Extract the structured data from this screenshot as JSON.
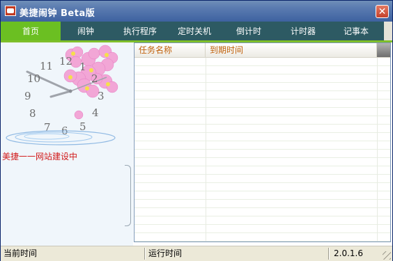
{
  "window": {
    "title": "美捷闹钟 Beta版"
  },
  "tabs": [
    {
      "label": "首页",
      "active": true
    },
    {
      "label": "闹钟"
    },
    {
      "label": "执行程序"
    },
    {
      "label": "定时关机"
    },
    {
      "label": "倒计时"
    },
    {
      "label": "计时器"
    },
    {
      "label": "记事本"
    }
  ],
  "clock": {
    "numbers": [
      "12",
      "1",
      "2",
      "3",
      "4",
      "5",
      "6",
      "7",
      "8",
      "9",
      "10",
      "11"
    ]
  },
  "left": {
    "website_note": "美捷一一网站建设中"
  },
  "tasklist": {
    "columns": [
      "任务名称",
      "到期时间"
    ],
    "rows": []
  },
  "status": {
    "current_time_label": "当前时间",
    "run_time_label": "运行时间",
    "version": "2.0.1.6"
  },
  "colors": {
    "tab_active": "#6bbf22",
    "tab_bar": "#2d5a63",
    "accent_red": "#d11a1a",
    "header_text": "#c0600a"
  },
  "icons": {
    "app": "alarm-app-icon",
    "close": "close-icon"
  }
}
